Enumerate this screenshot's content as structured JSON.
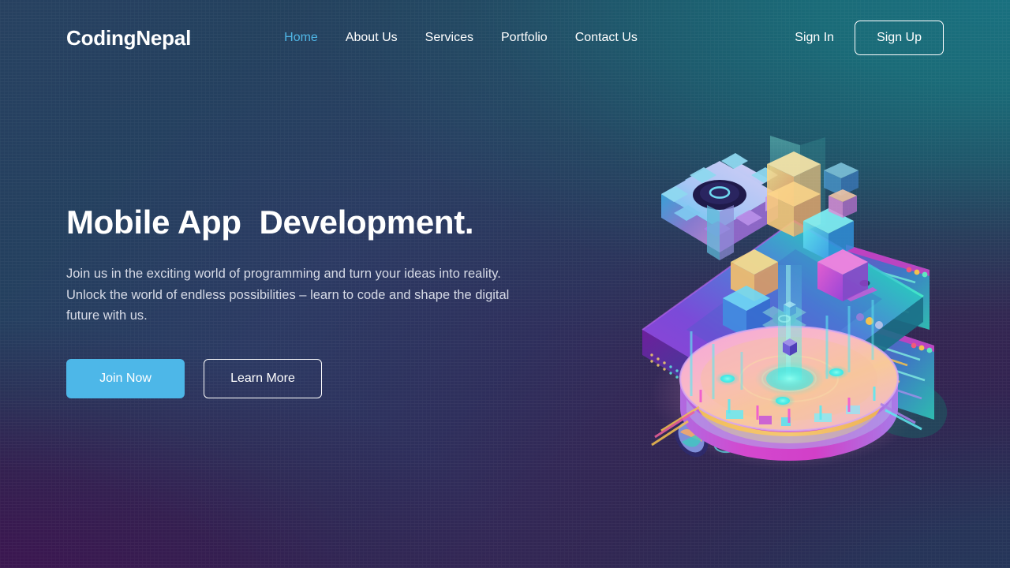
{
  "brand": {
    "logo": "CodingNepal"
  },
  "nav": {
    "links": [
      {
        "label": "Home",
        "active": true
      },
      {
        "label": "About Us",
        "active": false
      },
      {
        "label": "Services",
        "active": false
      },
      {
        "label": "Portfolio",
        "active": false
      },
      {
        "label": "Contact Us",
        "active": false
      }
    ],
    "signin_label": "Sign In",
    "signup_label": "Sign Up",
    "active_color": "#4fb5e5"
  },
  "hero": {
    "heading": "Mobile App  Development.",
    "paragraph": "Join us in the exciting world of programming and turn your ideas into reality. Unlock the world of endless possibilities – learn to code and shape the digital future with us.",
    "primary_button": "Join Now",
    "secondary_button": "Learn More",
    "primary_color": "#4db7e8"
  },
  "illustration": {
    "name": "isometric-mobile-app-development",
    "description": "Isometric smartphone on a glowing circular platform with gears, cubes and floating code windows"
  },
  "theme": {
    "bg_top_left": "#26405c",
    "bg_top_right": "#1d6170",
    "bg_bottom_left": "#36164a",
    "bg_bottom_right": "#23385a",
    "text_primary": "#ffffff",
    "text_muted": "#d6dae6"
  }
}
